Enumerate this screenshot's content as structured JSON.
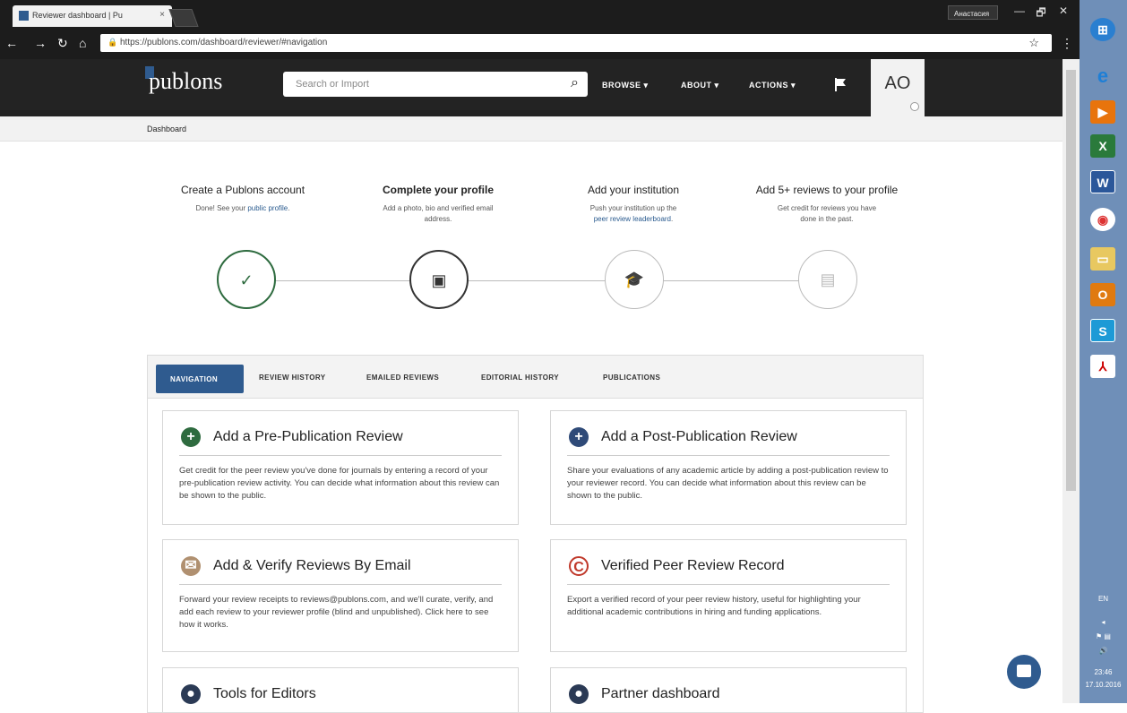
{
  "browser": {
    "tab_title": "Reviewer dashboard | Pu",
    "tab_close": "×",
    "user_label": "Анастасия",
    "url": "https://publons.com/dashboard/reviewer/#navigation",
    "minimize": "—",
    "maximize": "🗗",
    "close": "✕"
  },
  "header": {
    "logo": "publons",
    "search_placeholder": "Search or Import",
    "nav": [
      "BROWSE ▾",
      "ABOUT ▾",
      "ACTIONS ▾"
    ],
    "avatar_initials": "AO"
  },
  "breadcrumb": "Dashboard",
  "steps": [
    {
      "title": "Create a Publons account",
      "desc_pre": "Done! See your ",
      "link": "public profile",
      "desc_post": "."
    },
    {
      "title": "Complete your profile",
      "desc": "Add a photo, bio and verified email address."
    },
    {
      "title": "Add your institution",
      "desc_pre": "Push your institution up the ",
      "link": "peer review leaderboard",
      "desc_post": "."
    },
    {
      "title": "Add 5+ reviews to your profile",
      "desc": "Get credit for reviews you have done in the past."
    }
  ],
  "tabs": [
    "NAVIGATION",
    "REVIEW HISTORY",
    "EMAILED REVIEWS",
    "EDITORIAL HISTORY",
    "PUBLICATIONS"
  ],
  "cards": [
    {
      "title": "Add a Pre-Publication Review",
      "body": "Get credit for the peer review you've done for journals by entering a record of your pre-publication review activity. You can decide what information about this review can be shown to the public."
    },
    {
      "title": "Add a Post-Publication Review",
      "body": "Share your evaluations of any academic article by adding a post-publication review to your reviewer record. You can decide what information about this review can be shown to the public."
    },
    {
      "title": "Add & Verify Reviews By Email",
      "body": "Forward your review receipts to reviews@publons.com, and we'll curate, verify, and add each review to your reviewer profile (blind and unpublished). Click here to see how it works."
    },
    {
      "title": "Verified Peer Review Record",
      "body": "Export a verified record of your peer review history, useful for highlighting your additional academic contributions in hiring and funding applications."
    },
    {
      "title": "Tools for Editors",
      "body": ""
    },
    {
      "title": "Partner dashboard",
      "body": ""
    }
  ],
  "taskbar": {
    "lang": "EN",
    "time": "23:46",
    "date": "17.10.2016"
  },
  "colors": {
    "accent": "#2f5b8f",
    "green": "#2e6b3f",
    "header_bg": "#232323"
  }
}
